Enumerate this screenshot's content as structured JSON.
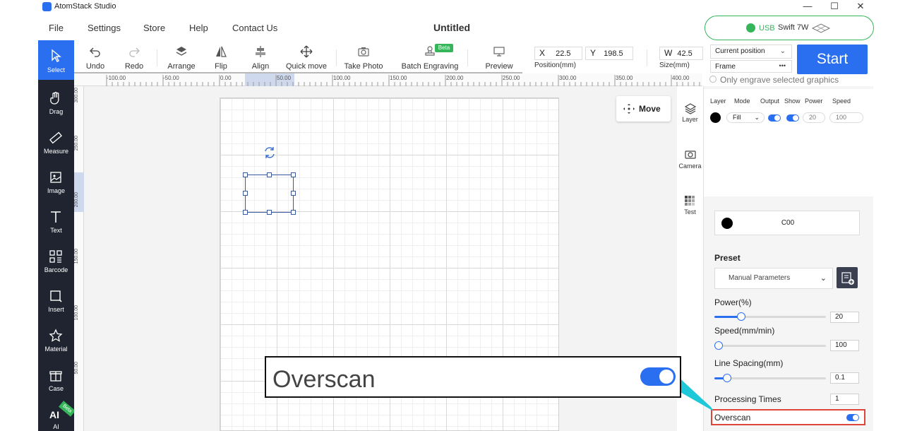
{
  "app": {
    "title": "AtomStack Studio",
    "document_title": "Untitled",
    "window_controls": [
      "—",
      "☐",
      "✕"
    ]
  },
  "menu": [
    "File",
    "Settings",
    "Store",
    "Help",
    "Contact Us"
  ],
  "device": {
    "connection": "USB",
    "name": "Swift 7W"
  },
  "left_toolbar": [
    {
      "label": "Select",
      "icon": "cursor-icon",
      "active": true
    },
    {
      "label": "Drag",
      "icon": "hand-icon"
    },
    {
      "label": "Measure",
      "icon": "ruler-icon"
    },
    {
      "label": "Image",
      "icon": "image-icon"
    },
    {
      "label": "Text",
      "icon": "text-icon"
    },
    {
      "label": "Barcode",
      "icon": "qr-code-icon"
    },
    {
      "label": "Insert",
      "icon": "insert-shape-icon"
    },
    {
      "label": "Material",
      "icon": "star-icon"
    },
    {
      "label": "Case",
      "icon": "gift-icon"
    },
    {
      "label": "AI",
      "icon": "ai-icon",
      "badge": "Beta"
    }
  ],
  "toolbar": {
    "undo": "Undo",
    "redo": "Redo",
    "arrange": "Arrange",
    "flip": "Flip",
    "align": "Align",
    "quick_move": "Quick move",
    "take_photo": "Take Photo",
    "batch_engraving": "Batch Engraving",
    "batch_badge": "Beta",
    "preview": "Preview",
    "position_label": "Position(mm)",
    "size_label": "Size(mm)",
    "x_prefix": "X",
    "x_value": "22.5",
    "y_prefix": "Y",
    "y_value": "198.5",
    "w_prefix": "W",
    "w_value": "42.5"
  },
  "run": {
    "position_mode": "Current position",
    "frame": "Frame",
    "frame_more": "•••",
    "start": "Start",
    "only_selected": "Only engrave selected graphics"
  },
  "rulers": {
    "top": [
      "-100.00",
      "-50.00",
      "0.00",
      "50.00",
      "100.00",
      "150.00",
      "200.00",
      "250.00",
      "300.00",
      "350.00",
      "400.00"
    ],
    "left": [
      "300.00",
      "250.00",
      "200.00",
      "150.00",
      "100.00",
      "50.00"
    ]
  },
  "canvas": {
    "move_button": "Move"
  },
  "side_tabs": [
    {
      "label": "Layer",
      "icon": "layers-icon"
    },
    {
      "label": "Camera",
      "icon": "camera-icon"
    },
    {
      "label": "Test",
      "icon": "grid-test-icon"
    }
  ],
  "layers": {
    "headers": [
      "Layer",
      "Mode",
      "Output",
      "Show",
      "Power",
      "Speed"
    ],
    "row": {
      "mode": "Fill",
      "power": "20",
      "speed": "100"
    }
  },
  "layer_detail": {
    "color_name": "C00",
    "preset_title": "Preset",
    "preset_value": "Manual Parameters",
    "power_label": "Power(%)",
    "power_value": "20",
    "power_fraction": 0.22,
    "speed_label": "Speed(mm/min)",
    "speed_value": "100",
    "speed_fraction": 0.0,
    "line_spacing_label": "Line Spacing(mm)",
    "line_spacing_value": "0.1",
    "line_spacing_fraction": 0.08,
    "processing_times_label": "Processing Times",
    "processing_times_value": "1",
    "overscan_label": "Overscan"
  },
  "callout": {
    "label": "Overscan"
  },
  "colors": {
    "accent": "#2a6ff0",
    "device_green": "#35b65a",
    "highlight_red": "#e0453a",
    "toolbar_dark": "#1f2430"
  }
}
